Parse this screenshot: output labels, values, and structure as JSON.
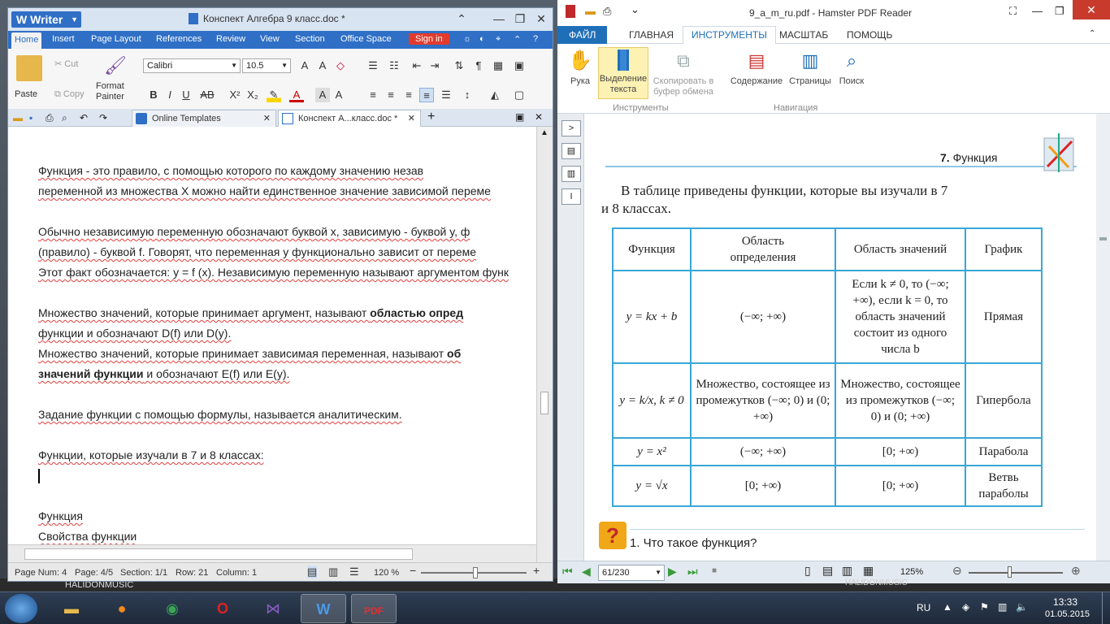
{
  "desktop": {
    "strip_text": "HALIDONMUSIC",
    "strip_text2": "HALIDONMUSIC"
  },
  "writer": {
    "app_name": "Writer",
    "title": "Конспект Алгебра 9 класс.doc *",
    "menu": [
      "Home",
      "Insert",
      "Page Layout",
      "References",
      "Review",
      "View",
      "Section",
      "Office Space"
    ],
    "signin": "Sign in",
    "clipboard": {
      "paste": "Paste",
      "cut": "Cut",
      "copy": "Copy",
      "format_painter": "Format Painter"
    },
    "font_name": "Calibri",
    "font_size": "10.5",
    "tabs": [
      {
        "label": "Online Templates"
      },
      {
        "label": "Конспект А...класс.doc *"
      }
    ],
    "paragraphs": [
      "Функция - это правило, с помощью которого по каждому значению незав",
      "переменной из множества X можно найти единственное значение зависимой переме",
      "Обычно независимую переменную обозначают буквой x, зависимую - буквой y, ф",
      "(правило) - буквой f. Говорят, что переменная y функционально зависит от переме",
      "Этот факт обозначается: y = f (x). Независимую переменную называют аргументом функ",
      "Множество значений, которые принимает аргумент, называют ",
      "областью опред",
      "функции и обозначают D(f) или D(y).",
      "Множество значений, которые принимает зависимая переменная, называют ",
      "об",
      "значений функции",
      " и обозначают E(f) или E(y).",
      "Задание функции с помощью формулы, называется аналитическим.",
      "Функции, которые изучали в 7 и 8 классах:",
      "Функция",
      "Свойства функции"
    ],
    "status": {
      "page_num": "Page Num: 4",
      "page": "Page: 4/5",
      "section": "Section: 1/1",
      "row": "Row: 21",
      "column": "Column: 1",
      "zoom": "120 %"
    }
  },
  "pdf": {
    "title": "9_a_m_ru.pdf - Hamster PDF Reader",
    "tabs": [
      "ФАЙЛ",
      "ГЛАВНАЯ",
      "ИНСТРУМЕНТЫ",
      "МАСШТАБ",
      "ПОМОЩЬ"
    ],
    "ribbon": {
      "hand": "Рука",
      "select_text": "Выделение текста",
      "copy_clip": "Скопировать в буфер обмена",
      "contents": "Содержание",
      "pages": "Страницы",
      "search": "Поиск",
      "group_tools": "Инструменты",
      "group_nav": "Навигация"
    },
    "page": {
      "header_num": "7.",
      "header_title": "Функция",
      "intro_line1": "В таблице приведены функции, которые вы изучали в 7",
      "intro_line2": "и 8 классах.",
      "table_headers": [
        "Функция",
        "Область определения",
        "Область значений",
        "График"
      ],
      "rows": [
        {
          "func": "y = kx + b",
          "domain": "(−∞; +∞)",
          "range": "Если k ≠ 0, то (−∞; +∞), если k = 0, то область значений состоит из одного числа b",
          "graph": "Прямая"
        },
        {
          "func": "y = k/x, k ≠ 0",
          "domain": "Множество, состоящее из промежутков (−∞; 0) и (0; +∞)",
          "range": "Множество, состоящее из промежутков (−∞; 0) и (0; +∞)",
          "graph": "Гипербола"
        },
        {
          "func": "y = x²",
          "domain": "(−∞; +∞)",
          "range": "[0; +∞)",
          "graph": "Парабола"
        },
        {
          "func": "y = √x",
          "domain": "[0; +∞)",
          "range": "[0; +∞)",
          "graph": "Ветвь параболы"
        }
      ],
      "question": "1. Что такое функция?"
    },
    "page_box": "61/230",
    "zoom": "125%"
  },
  "taskbar": {
    "lang": "RU",
    "time": "13:33",
    "date": "01.05.2015"
  }
}
